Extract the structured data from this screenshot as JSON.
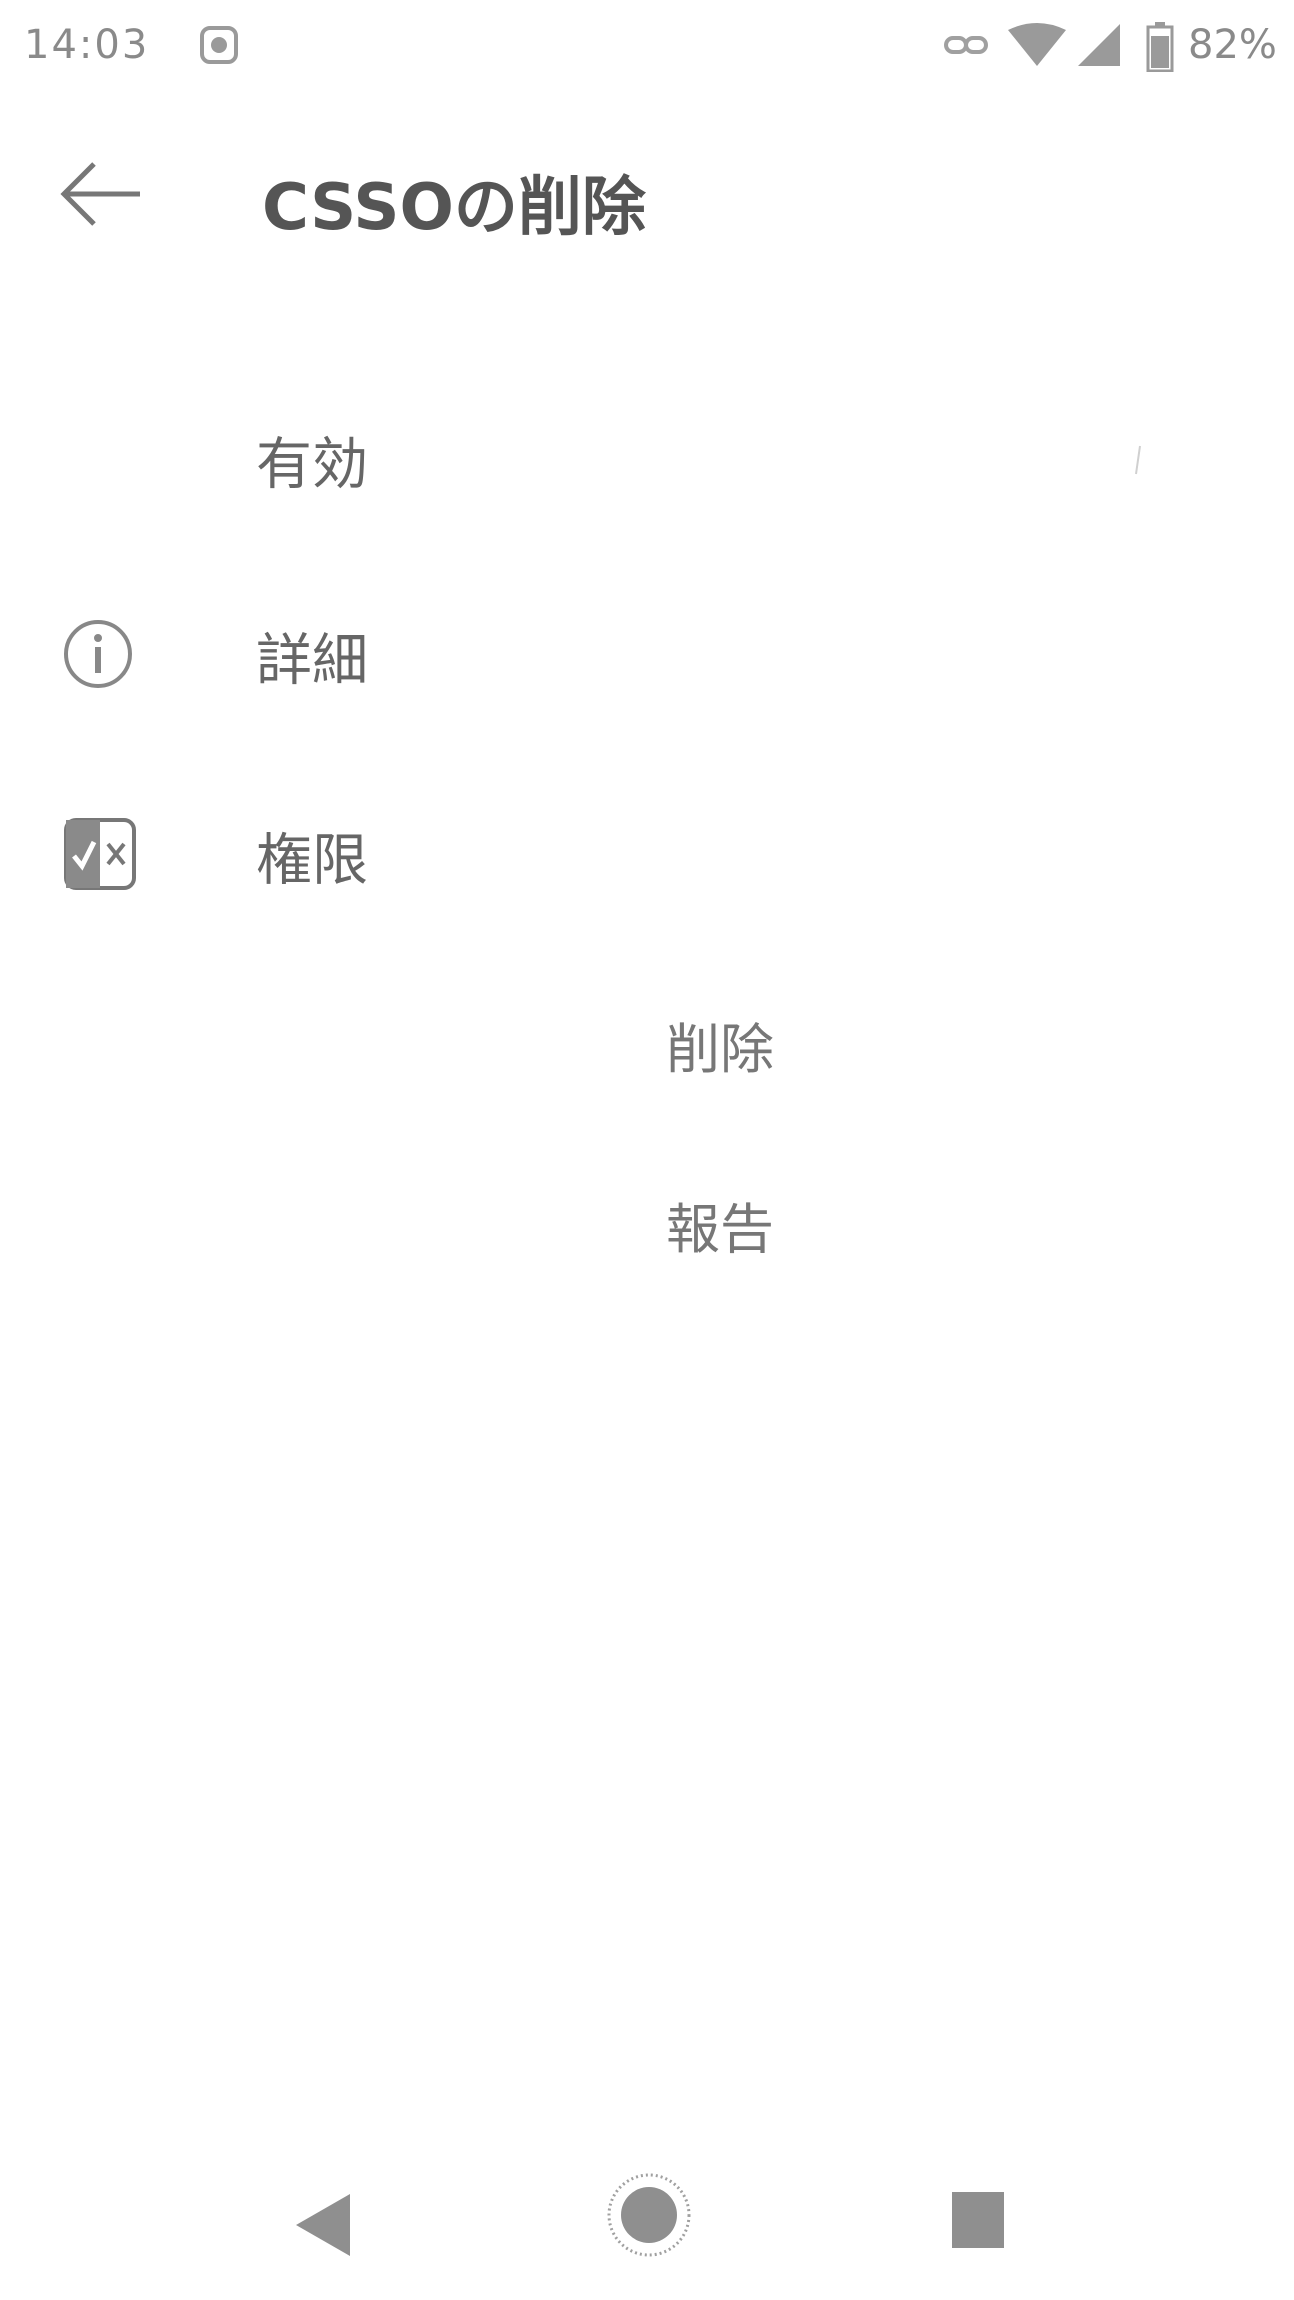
{
  "status_bar": {
    "time": "14:03",
    "battery_percent": "82%"
  },
  "header": {
    "title": "CSSOの削除"
  },
  "rows": {
    "enabled_label": "有効",
    "details_label": "詳細",
    "permissions_label": "権限"
  },
  "actions": {
    "delete_label": "削除",
    "report_label": "報告"
  },
  "icons": {
    "back": "arrow-left-icon",
    "details": "info-icon",
    "permissions": "permission-icon",
    "nav_back": "triangle-back-icon",
    "nav_home": "circle-home-icon",
    "nav_recents": "square-recents-icon"
  }
}
